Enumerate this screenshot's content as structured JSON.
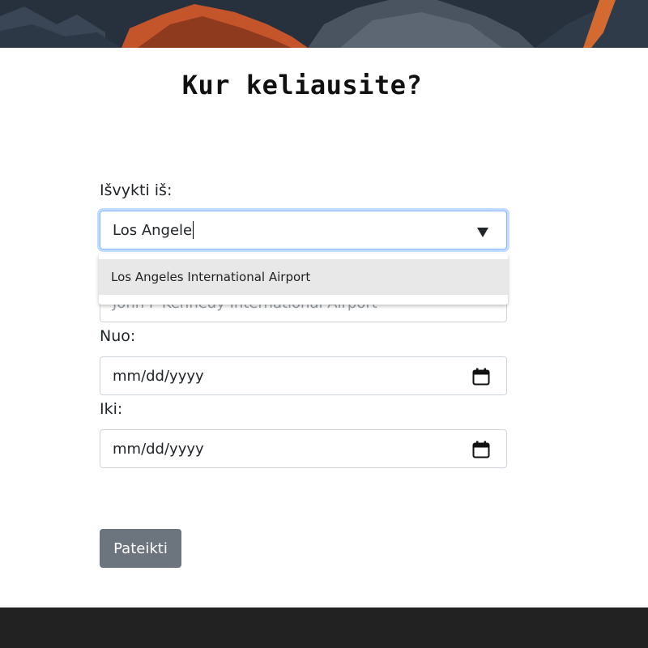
{
  "form": {
    "title": "Kur keliausite?",
    "departure": {
      "label": "Išvykti iš:",
      "value": "Los Angele",
      "suggestions": [
        "Los Angeles International Airport"
      ]
    },
    "destination": {
      "value": "John F Kennedy International Airport"
    },
    "from_date": {
      "label": "Nuo:",
      "placeholder": "mm/dd/yyyy"
    },
    "to_date": {
      "label": "Iki:",
      "placeholder": "mm/dd/yyyy"
    },
    "submit_label": "Pateikti"
  },
  "colors": {
    "submit_bg": "#6c757d",
    "focus_border": "#86b7fe",
    "footer_bg": "#222222",
    "suggestion_bg": "#e8e8e8"
  },
  "icons": {
    "dropdown": "caret-down-icon",
    "date": "calendar-icon"
  }
}
